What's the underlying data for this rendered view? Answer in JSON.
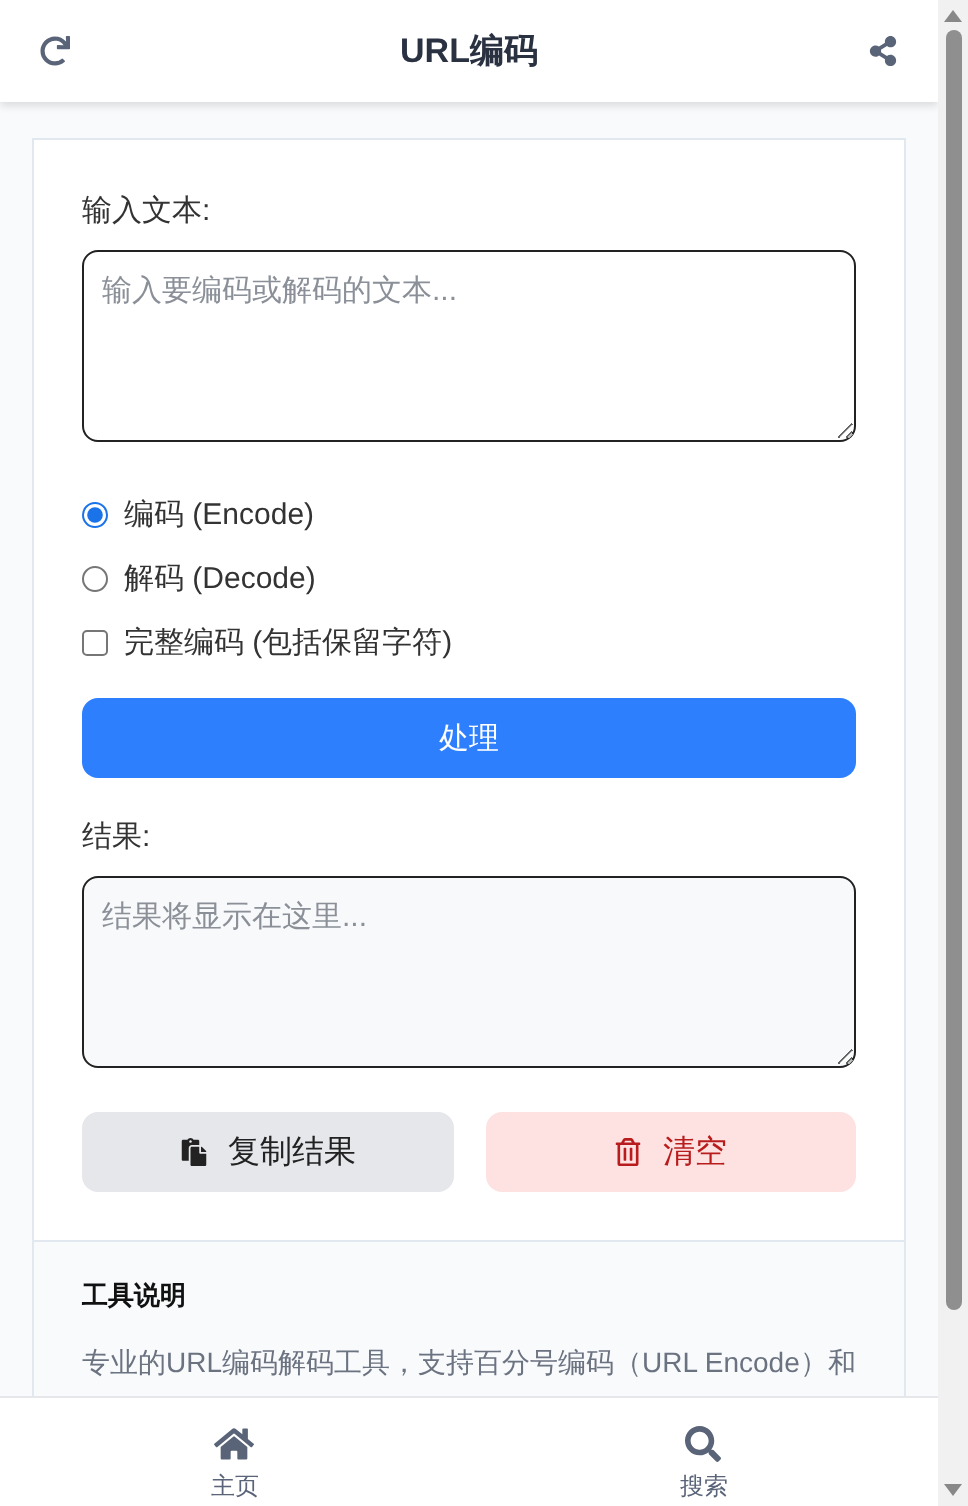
{
  "header": {
    "title": "URL编码"
  },
  "input": {
    "label": "输入文本:",
    "placeholder": "输入要编码或解码的文本..."
  },
  "options": [
    {
      "kind": "radio",
      "label": "编码 (Encode)",
      "selected": true
    },
    {
      "kind": "radio",
      "label": "解码 (Decode)",
      "selected": false
    },
    {
      "kind": "checkbox",
      "label": "完整编码 (包括保留字符)",
      "checked": false
    }
  ],
  "process_button": "处理",
  "result": {
    "label": "结果:",
    "placeholder": "结果将显示在这里..."
  },
  "actions": [
    {
      "kind": "copy",
      "label": "复制结果"
    },
    {
      "kind": "clear",
      "label": "清空"
    }
  ],
  "info": {
    "title": "工具说明",
    "text": "专业的URL编码解码工具，支持百分号编码（URL Encode）和"
  },
  "bottom_nav": [
    {
      "kind": "home",
      "label": "主页"
    },
    {
      "kind": "search",
      "label": "搜索"
    }
  ]
}
